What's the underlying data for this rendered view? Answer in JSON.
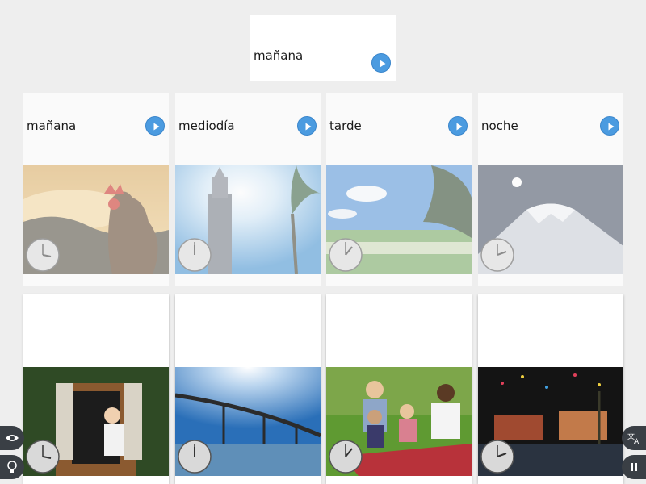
{
  "prompt": {
    "word": "mañana",
    "icon": "play-icon"
  },
  "answer_cards": [
    {
      "word": "mañana",
      "image": "rooster-sunrise"
    },
    {
      "word": "mediodía",
      "image": "tower-sun"
    },
    {
      "word": "tarde",
      "image": "afternoon-field"
    },
    {
      "word": "noche",
      "image": "volcano-moon"
    }
  ],
  "choice_cards": [
    {
      "image": "woman-window-morning"
    },
    {
      "image": "bridge-noon"
    },
    {
      "image": "family-picnic"
    },
    {
      "image": "town-night-lights"
    }
  ],
  "side_controls": {
    "left": [
      "eye-icon",
      "lightbulb-icon"
    ],
    "right": [
      "translate-icon",
      "pause-icon"
    ]
  },
  "colors": {
    "accent": "#4b9be0",
    "background": "#eeeeee",
    "control": "#3a3f45"
  }
}
